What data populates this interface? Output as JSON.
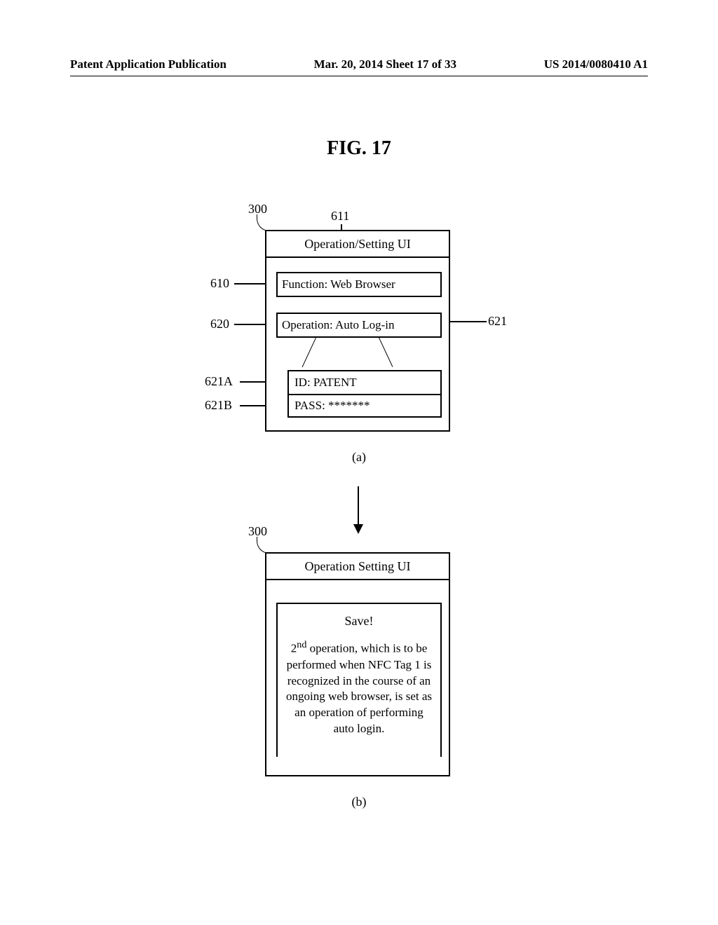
{
  "header": {
    "left": "Patent Application Publication",
    "center": "Mar. 20, 2014  Sheet 17 of 33",
    "right": "US 2014/0080410 A1"
  },
  "figure_title": "FIG. 17",
  "refs": {
    "r300": "300",
    "r611": "611",
    "r610": "610",
    "r620": "620",
    "r621": "621",
    "r621A": "621A",
    "r621B": "621B"
  },
  "panelA": {
    "title": "Operation/Setting UI",
    "function_row": "Function: Web Browser",
    "operation_row": "Operation: Auto Log-in",
    "id_row": "ID: PATENT",
    "pass_row": "PASS: *******"
  },
  "panelB": {
    "title": "Operation Setting UI",
    "save": "Save!",
    "body_html": "2<sup>nd</sup> operation, which is to be performed when NFC Tag 1 is recognized in the course of an ongoing web browser, is set as an operation of performing auto login."
  },
  "captions": {
    "a": "(a)",
    "b": "(b)"
  }
}
